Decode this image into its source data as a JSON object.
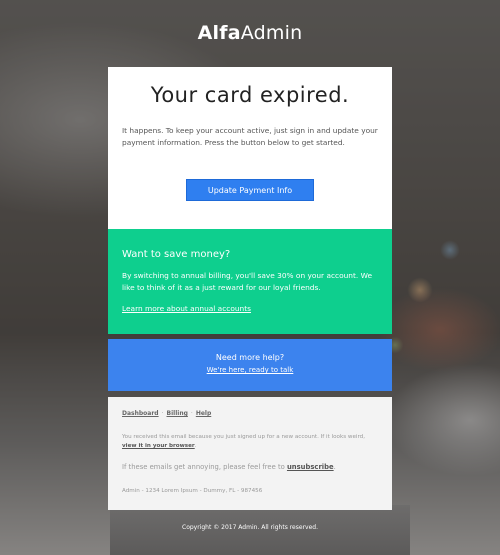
{
  "header": {
    "logo_bold": "Alfa",
    "logo_light": "Admin"
  },
  "main": {
    "title": "Your card expired.",
    "body": "It happens. To keep your account active, just sign in and update your payment information. Press the button below to get started.",
    "button_label": "Update Payment Info"
  },
  "promo": {
    "heading": "Want to save money?",
    "body": "By switching to annual billing, you'll save 30% on your account. We like to think of it as a just reward for our loyal friends.",
    "link": "Learn more about annual accounts"
  },
  "help": {
    "heading": "Need more help?",
    "link": "We're here, ready to talk"
  },
  "footer": {
    "links": [
      "Dashboard",
      "Billing",
      "Help"
    ],
    "separator": "·",
    "note_prefix": "You received this email because you just signed up for a new account. If it looks weird,",
    "note_link": "view it in your browser",
    "note_suffix": ".",
    "annoy_prefix": "If these emails get annoying, please feel free to",
    "annoy_link": "unsubscribe",
    "annoy_suffix": ".",
    "address": "Admin - 1234 Lorem Ipsum - Dummy, FL - 987456",
    "copyright": "Copyright © 2017 Admin. All rights reserved."
  },
  "colors": {
    "button": "#2f7ff0",
    "promo": "#0ecf8e",
    "help": "#3c83ee",
    "footer_bg": "#f3f3f3"
  }
}
